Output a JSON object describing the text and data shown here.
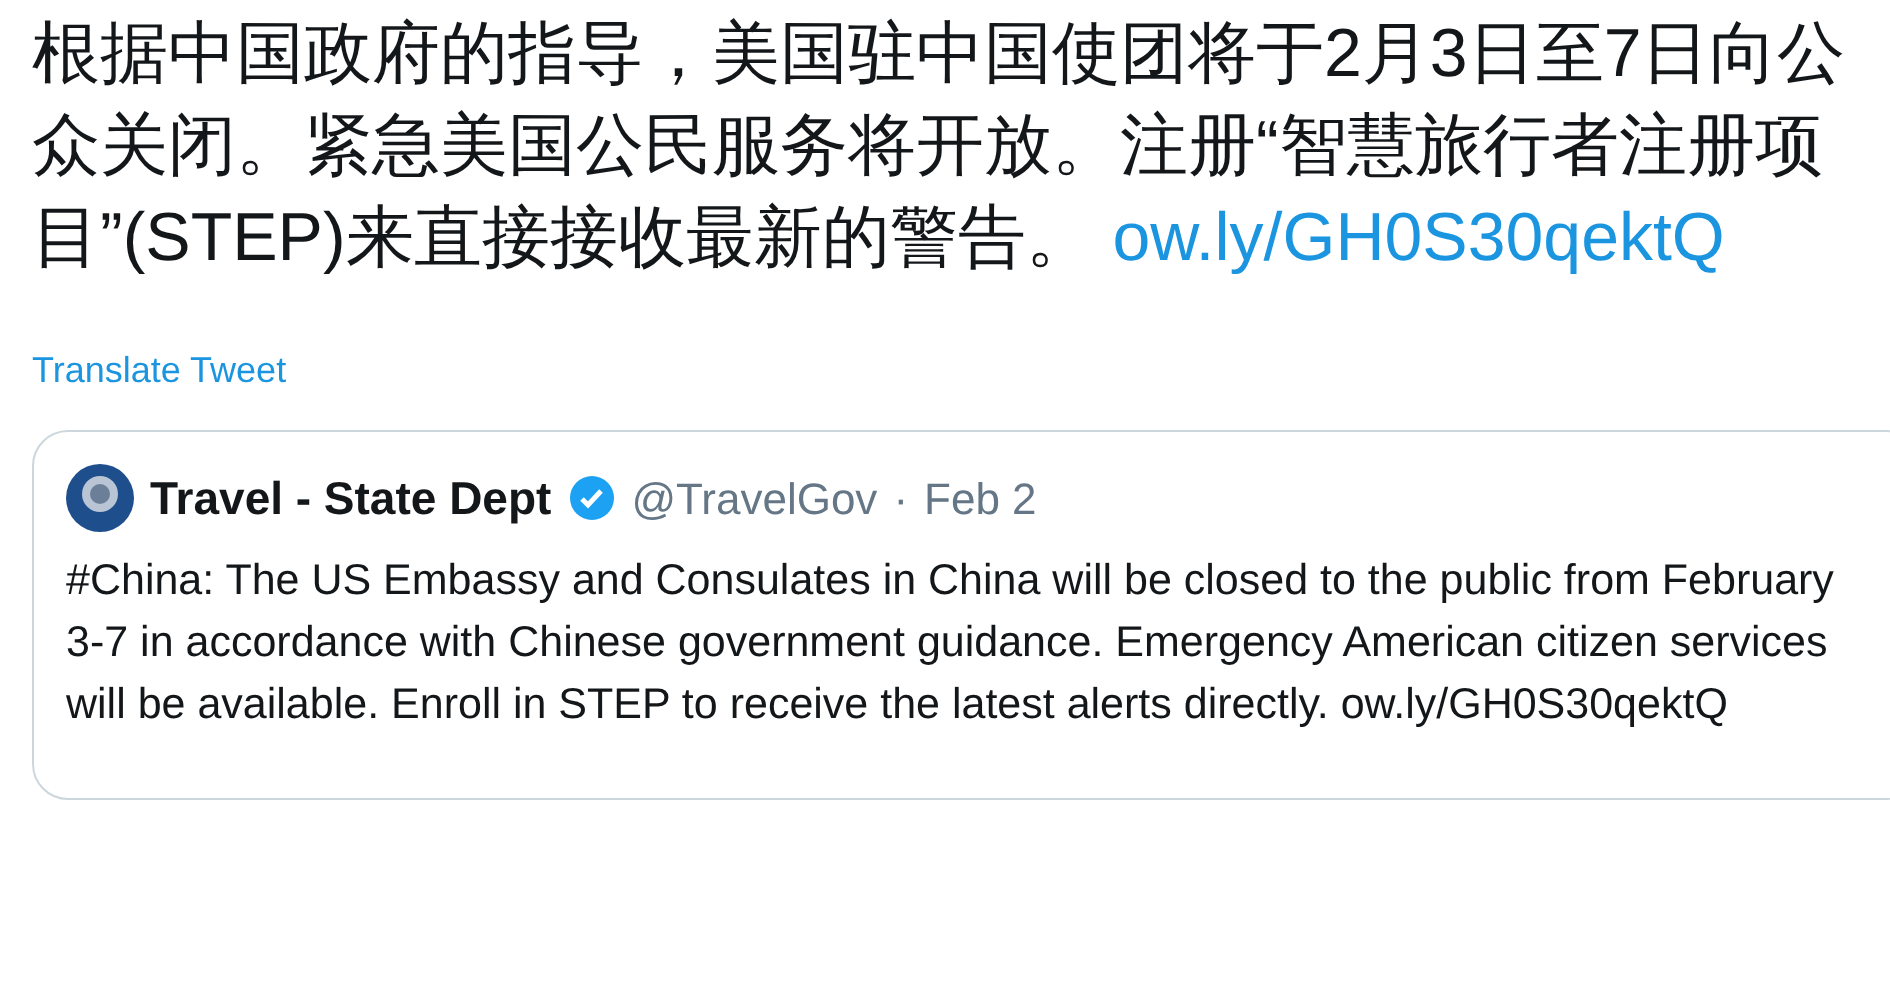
{
  "tweet": {
    "text": "根据中国政府的指导，美国驻中国使团将于2月3日至7日向公众关闭。紧急美国公民服务将开放。注册“智慧旅行者注册项目”(STEP)来直接接收最新的警告。",
    "link": "ow.ly/GH0S30qektQ",
    "translate": "Translate Tweet"
  },
  "quoted_tweet": {
    "name": "Travel - State Dept",
    "verified": true,
    "handle": "@TravelGov",
    "separator": "·",
    "date": "Feb 2",
    "text": "#China: The US Embassy and Consulates in China will be closed to the public from February 3-7 in accordance with Chinese government guidance. Emergency American citizen services will be available. Enroll in STEP to receive the latest alerts directly. ow.ly/GH0S30qektQ"
  }
}
